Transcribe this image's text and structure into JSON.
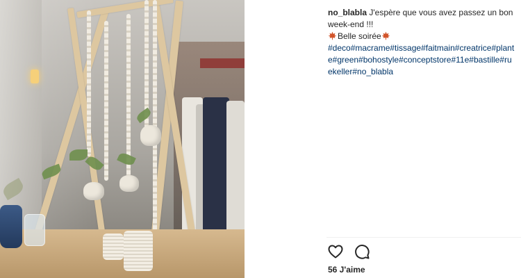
{
  "post": {
    "username": "no_blabla",
    "caption_line1": "J'espère que vous avez passez un bon week-end !!!",
    "caption_line2": "Belle soirée",
    "hashtags": "#deco#macrame#tissage#faitmain#creatrice#plante#green#bohostyle#conceptstore#11e#bastille#ruekeller#no_blabla",
    "leaf_icons": [
      "maple-leaf-icon",
      "maple-leaf-icon"
    ]
  },
  "actions": {
    "like_icon": "heart-icon",
    "comment_icon": "comment-icon",
    "likes_label": "56 J'aime"
  },
  "colors": {
    "text": "#262626",
    "hashtag": "#003569",
    "divider": "#efefef",
    "maple": "#d2542a"
  }
}
